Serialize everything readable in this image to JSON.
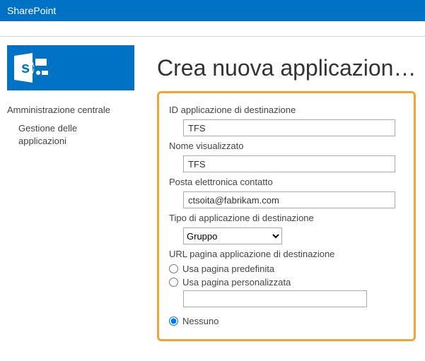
{
  "suite": {
    "brand": "SharePoint"
  },
  "nav": {
    "admin_center": "Amministrazione centrale",
    "app_mgmt": "Gestione delle applicazioni"
  },
  "page": {
    "title": "Crea nuova applicazion…"
  },
  "form": {
    "target_app_id": {
      "label": "ID applicazione di destinazione",
      "value": "TFS"
    },
    "display_name": {
      "label": "Nome visualizzato",
      "value": "TFS"
    },
    "contact_email": {
      "label": "Posta elettronica contatto",
      "value": "ctsoita@fabrikam.com"
    },
    "target_app_type": {
      "label": "Tipo di applicazione di destinazione",
      "selected": "Gruppo",
      "options": [
        "Gruppo"
      ]
    },
    "page_url": {
      "label": "URL pagina applicazione di destinazione",
      "opt_default": "Usa pagina predefinita",
      "opt_custom": "Usa pagina personalizzata",
      "opt_none": "Nessuno",
      "custom_value": "",
      "selected": "none"
    }
  }
}
